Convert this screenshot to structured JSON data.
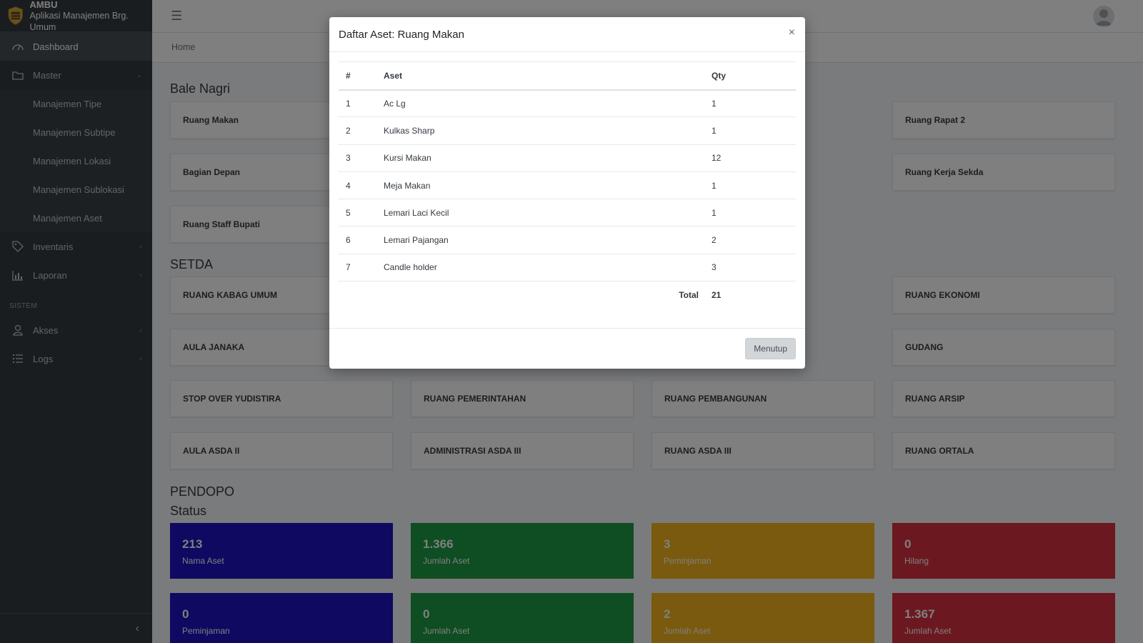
{
  "brand": {
    "title": "AMBU",
    "subtitle": "Aplikasi Manajemen Brg. Umum"
  },
  "sidebar": {
    "dashboard": "Dashboard",
    "master": "Master",
    "master_items": [
      "Manajemen Tipe",
      "Manajemen Subtipe",
      "Manajemen Lokasi",
      "Manajemen Sublokasi",
      "Manajemen Aset"
    ],
    "inventaris": "Inventaris",
    "laporan": "Laporan",
    "header_sistem": "SISTEM",
    "akses": "Akses",
    "logs": "Logs"
  },
  "breadcrumb": "Home",
  "sections": {
    "bale_nagri": "Bale Nagri",
    "setda": "SETDA",
    "pendopo": "PENDOPO",
    "status": "Status"
  },
  "rooms": {
    "bale": [
      "Ruang Makan",
      "Ruang Rapat 2",
      "Bagian Depan",
      "Ruang Kerja Sekda",
      "Ruang Staff Bupati"
    ],
    "setda": [
      "RUANG KABAG UMUM",
      "RUANG EKONOMI",
      "AULA JANAKA",
      "GUDANG",
      "STOP OVER YUDISTIRA",
      "RUANG PEMERINTAHAN",
      "RUANG PEMBANGUNAN",
      "RUANG ARSIP",
      "AULA ASDA II",
      "ADMINISTRASI ASDA III",
      "RUANG ASDA III",
      "RUANG ORTALA"
    ]
  },
  "stats": [
    {
      "num": "213",
      "label": "Nama Aset"
    },
    {
      "num": "1.366",
      "label": "Jumlah Aset"
    },
    {
      "num": "3",
      "label": "Peminjaman"
    },
    {
      "num": "0",
      "label": "Hilang"
    },
    {
      "num": "0",
      "label": "Peminjaman"
    },
    {
      "num": "0",
      "label": "Jumlah Aset"
    },
    {
      "num": "2",
      "label": "Jumlah Aset"
    },
    {
      "num": "1.367",
      "label": "Jumlah Aset"
    }
  ],
  "modal": {
    "title": "Daftar Aset: Ruang Makan",
    "close_symbol": "×",
    "headers": {
      "no": "#",
      "aset": "Aset",
      "qty": "Qty"
    },
    "rows": [
      {
        "no": "1",
        "aset": "Ac Lg",
        "qty": "1"
      },
      {
        "no": "2",
        "aset": "Kulkas Sharp",
        "qty": "1"
      },
      {
        "no": "3",
        "aset": "Kursi Makan",
        "qty": "12"
      },
      {
        "no": "4",
        "aset": "Meja Makan",
        "qty": "1"
      },
      {
        "no": "5",
        "aset": "Lemari Laci Kecil",
        "qty": "1"
      },
      {
        "no": "6",
        "aset": "Lemari Pajangan",
        "qty": "2"
      },
      {
        "no": "7",
        "aset": "Candle holder",
        "qty": "3"
      }
    ],
    "total_label": "Total",
    "total_value": "21",
    "button": "Menutup"
  }
}
